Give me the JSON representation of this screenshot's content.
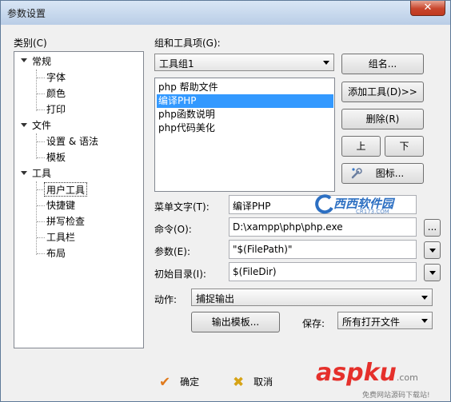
{
  "window": {
    "title": "参数设置",
    "close_label": "✕"
  },
  "category": {
    "label": "类别(C)",
    "tree": [
      {
        "label": "常规",
        "children": [
          "字体",
          "颜色",
          "打印"
        ]
      },
      {
        "label": "文件",
        "children": [
          "设置 & 语法",
          "模板"
        ]
      },
      {
        "label": "工具",
        "children": [
          "用户工具",
          "快捷键",
          "拼写检查",
          "工具栏",
          "布局"
        ]
      }
    ]
  },
  "groups": {
    "label": "组和工具项(G):",
    "selected_group": "工具组1",
    "items": [
      "php 帮助文件",
      "编译PHP",
      "php函数说明",
      "php代码美化"
    ],
    "selected_index": 1
  },
  "buttons": {
    "group": "组名...",
    "add_tool": "添加工具(D)>>",
    "delete": "删除(R)",
    "up": "上",
    "down": "下",
    "icon": "图标..."
  },
  "fields": {
    "menu_text_label": "菜单文字(T):",
    "menu_text_value": "编译PHP",
    "command_label": "命令(O):",
    "command_value": "D:\\xampp\\php\\php.exe",
    "command_browse": "...",
    "params_label": "参数(E):",
    "params_value": "\"$(FilePath)\"",
    "initdir_label": "初始目录(I):",
    "initdir_value": "$(FileDir)",
    "action_label": "动作:",
    "action_value": "捕捉输出",
    "output_template": "输出模板...",
    "save_label": "保存:",
    "save_value": "所有打开文件"
  },
  "footer": {
    "ok": "确定",
    "cancel": "取消"
  },
  "watermark": {
    "site": "asp",
    "site2": "ku",
    "suffix": ".com",
    "slogan": "免费网站源码下载站!",
    "logo_text": "西西软件园",
    "logo_sub": "CR173.COM"
  },
  "colors": {
    "selection": "#3399ff",
    "close": "#c8452c",
    "watermark_red": "#e5302b"
  }
}
